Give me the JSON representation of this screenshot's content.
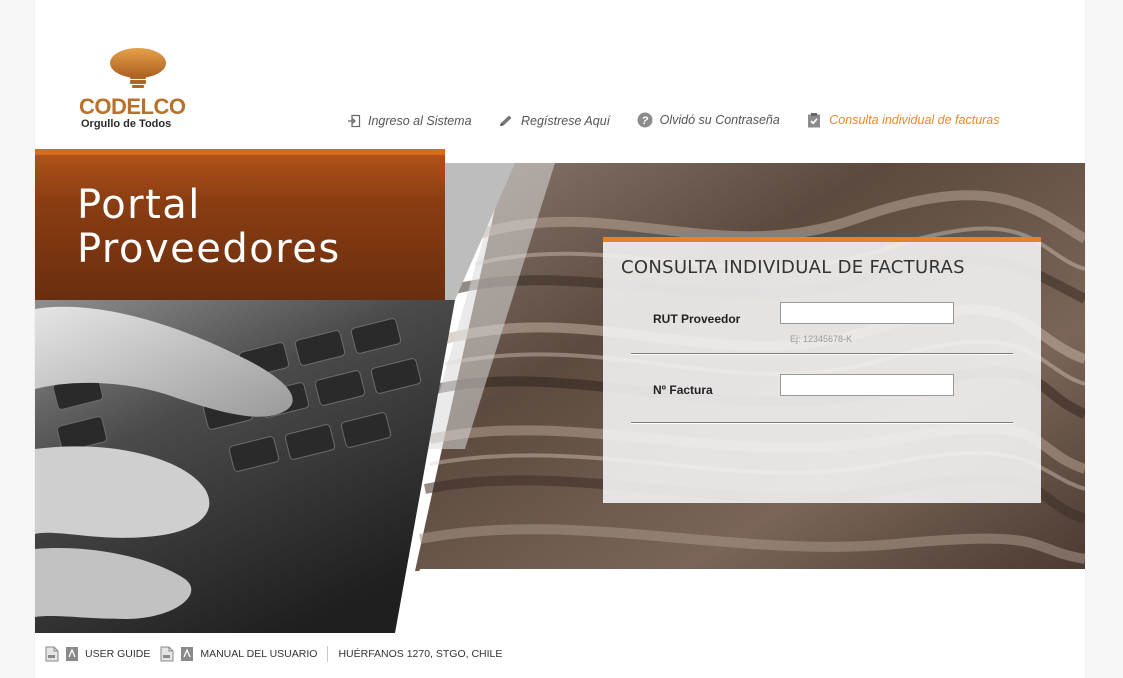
{
  "brand": {
    "name": "CODELCO",
    "tagline": "Orgullo de Todos",
    "color": "#b9722c"
  },
  "nav": {
    "items": [
      {
        "label": "Ingreso al Sistema",
        "icon": "login-icon"
      },
      {
        "label": "Regístrese Aquí",
        "icon": "pencil-icon"
      },
      {
        "label": "Olvidó su Contraseña",
        "icon": "help-icon"
      },
      {
        "label": "Consulta individual de facturas",
        "icon": "clipboard-check-icon",
        "active": true
      }
    ],
    "active_color": "#e8892e"
  },
  "hero": {
    "title_line1": "Portal",
    "title_line2": "Proveedores"
  },
  "form": {
    "title": "CONSULTA INDIVIDUAL DE FACTURAS",
    "rut_label": "RUT Proveedor",
    "rut_value": "",
    "rut_hint": "Ej: 12345678-K",
    "factura_label": "Nº Factura",
    "factura_value": "",
    "accent": "#e8822a"
  },
  "footer": {
    "user_guide": "USER GUIDE",
    "manual": "MANUAL DEL USUARIO",
    "address": "HUÉRFANOS 1270, STGO, CHILE"
  }
}
